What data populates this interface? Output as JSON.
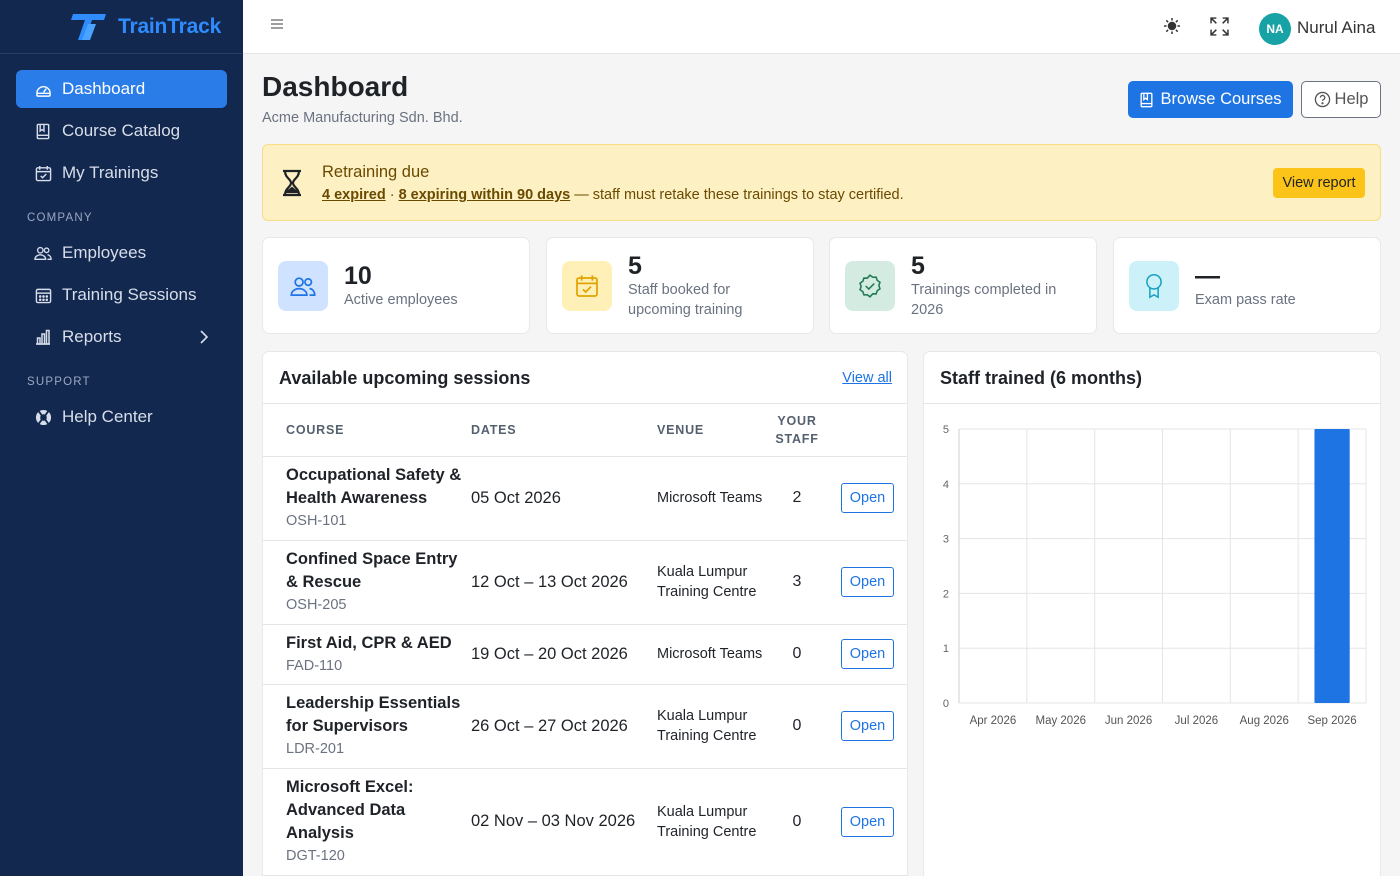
{
  "app": {
    "brand": "TrainTrack"
  },
  "sidebar": {
    "items": [
      {
        "label": "Dashboard",
        "icon": "dashboard-icon",
        "active": true
      },
      {
        "label": "Course Catalog",
        "icon": "book-icon"
      },
      {
        "label": "My Trainings",
        "icon": "calendar-check-icon"
      }
    ],
    "company_label": "COMPANY",
    "company_items": [
      {
        "label": "Employees",
        "icon": "users-icon"
      },
      {
        "label": "Training Sessions",
        "icon": "calendar-grid-icon"
      },
      {
        "label": "Reports",
        "icon": "bar-chart-icon"
      }
    ],
    "support_label": "SUPPORT",
    "support_items": [
      {
        "label": "Help Center",
        "icon": "lifebuoy-icon"
      }
    ]
  },
  "topbar": {
    "avatar_initials": "NA",
    "user_name": "Nurul Aina"
  },
  "page": {
    "title": "Dashboard",
    "subtitle": "Acme Manufacturing Sdn. Bhd.",
    "browse_label": "Browse Courses",
    "help_label": "Help"
  },
  "alert": {
    "title": "Retraining due",
    "expired_link": "4 expired",
    "separator": "·",
    "expiring_link": "8 expiring within 90 days",
    "message": "— staff must retake these trainings to stay certified.",
    "button": "View report"
  },
  "stats": [
    {
      "value": "10",
      "label": "Active employees"
    },
    {
      "value": "5",
      "label": "Staff booked for upcoming training"
    },
    {
      "value": "5",
      "label": "Trainings completed in 2026"
    },
    {
      "value": "—",
      "label": "Exam pass rate"
    }
  ],
  "sessions": {
    "title": "Available upcoming sessions",
    "view_all": "View all",
    "columns": {
      "course": "COURSE",
      "dates": "DATES",
      "venue": "VENUE",
      "staff": "YOUR STAFF"
    },
    "open_label": "Open",
    "rows": [
      {
        "course": "Occupational Safety & Health Awareness",
        "code": "OSH-101",
        "dates": "05 Oct 2026",
        "venue": "Microsoft Teams",
        "staff": "2"
      },
      {
        "course": "Confined Space Entry & Rescue",
        "code": "OSH-205",
        "dates": "12 Oct – 13 Oct 2026",
        "venue": "Kuala Lumpur Training Centre",
        "staff": "3"
      },
      {
        "course": "First Aid, CPR & AED",
        "code": "FAD-110",
        "dates": "19 Oct – 20 Oct 2026",
        "venue": "Microsoft Teams",
        "staff": "0"
      },
      {
        "course": "Leadership Essentials for Supervisors",
        "code": "LDR-201",
        "dates": "26 Oct – 27 Oct 2026",
        "venue": "Kuala Lumpur Training Centre",
        "staff": "0"
      },
      {
        "course": "Microsoft Excel: Advanced Data Analysis",
        "code": "DGT-120",
        "dates": "02 Nov – 03 Nov 2026",
        "venue": "Kuala Lumpur Training Centre",
        "staff": "0"
      }
    ]
  },
  "chart_data": {
    "type": "bar",
    "title": "Staff trained (6 months)",
    "categories": [
      "Apr 2026",
      "May 2026",
      "Jun 2026",
      "Jul 2026",
      "Aug 2026",
      "Sep 2026"
    ],
    "values": [
      0,
      0,
      0,
      0,
      0,
      5
    ],
    "ylim": [
      0,
      5
    ],
    "yticks": [
      0,
      1,
      2,
      3,
      4,
      5
    ],
    "grid": true,
    "bar_color": "#1e74e3"
  }
}
